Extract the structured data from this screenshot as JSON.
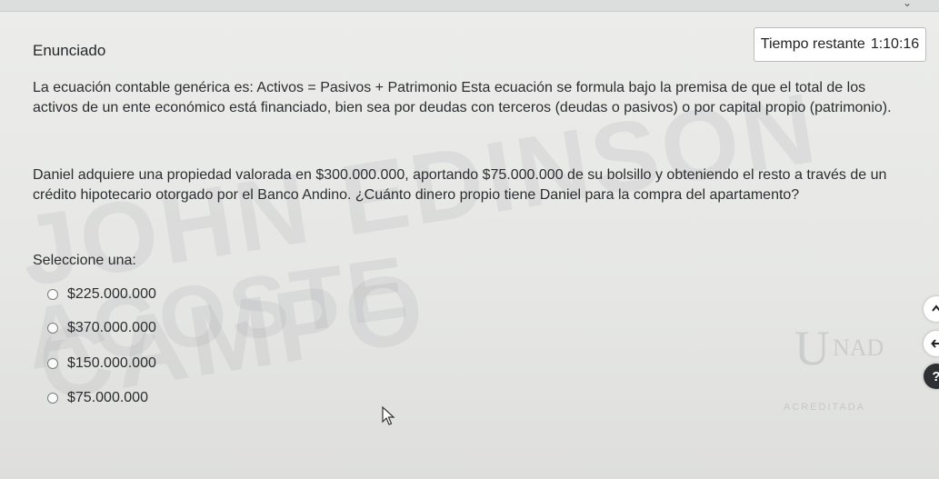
{
  "header": {
    "title": "Enunciado",
    "timer_label": "Tiempo restante",
    "timer_value": "1:10:16"
  },
  "question": {
    "paragraph_1": "La ecuación contable genérica es: Activos = Pasivos + Patrimonio Esta ecuación se formula bajo la premisa de que el total de los activos de un ente económico está financiado, bien sea por deudas con terceros (deudas o pasivos) o por capital propio (patrimonio).",
    "paragraph_2": "Daniel adquiere una propiedad valorada en $300.000.000, aportando $75.000.000 de su bolsillo y obteniendo el resto a través de un crédito hipotecario otorgado por el Banco Andino. ¿Cuánto dinero propio tiene Daniel para la compra del apartamento?",
    "prompt": "Seleccione una:"
  },
  "options": [
    {
      "label": "$225.000.000",
      "selected": false
    },
    {
      "label": "$370.000.000",
      "selected": false
    },
    {
      "label": "$150.000.000",
      "selected": false
    },
    {
      "label": "$75.000.000",
      "selected": false
    }
  ],
  "watermark": {
    "line_1": "JOHN EDINSON CAMPO",
    "line_2": "ACOSTE"
  },
  "logo": {
    "u": "U",
    "nad": "NAD",
    "badge": "ACREDITADA"
  },
  "side_buttons": {
    "up_icon": "chevron-up-icon",
    "back_icon": "arrow-left-icon",
    "help_icon": "question-icon",
    "help_glyph": "?"
  }
}
